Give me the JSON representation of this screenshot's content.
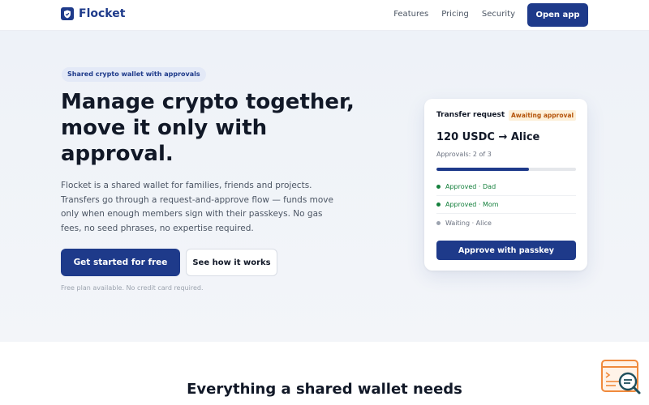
{
  "colors": {
    "brand": "#1e3a8a",
    "approved": "#15803d",
    "waiting": "#9ca3af",
    "badge_text": "#b45309"
  },
  "header": {
    "brand_name": "Flocket",
    "brand_icon": "shield-check-icon",
    "nav": [
      {
        "label": "Features"
      },
      {
        "label": "Pricing"
      },
      {
        "label": "Security"
      }
    ],
    "cta_label": "Open app"
  },
  "hero": {
    "eyebrow": "Shared crypto wallet with approvals",
    "headline": "Manage crypto together, move it only with approval.",
    "lead": "Flocket is a shared wallet for families, friends and projects. Transfers go through a request-and-approve flow — funds move only when enough members sign with their passkeys. No gas fees, no seed phrases, no expertise required.",
    "primary_cta": "Get started for free",
    "secondary_cta": "See how it works",
    "fineprint": "Free plan available. No credit card required."
  },
  "card": {
    "title": "Transfer request",
    "status": "Awaiting approval",
    "amount": "120 USDC → Alice",
    "approvals_label": "Approvals: 2 of 3",
    "progress_fraction": 0.66,
    "rows": [
      {
        "text": "Approved · Dad",
        "state": "approved"
      },
      {
        "text": "Approved · Mom",
        "state": "approved"
      },
      {
        "text": "Waiting · Alice",
        "state": "waiting"
      }
    ],
    "action_label": "Approve with passkey"
  },
  "features": {
    "title": "Everything a shared wallet needs"
  },
  "widget": {
    "icon": "search-console-icon"
  }
}
